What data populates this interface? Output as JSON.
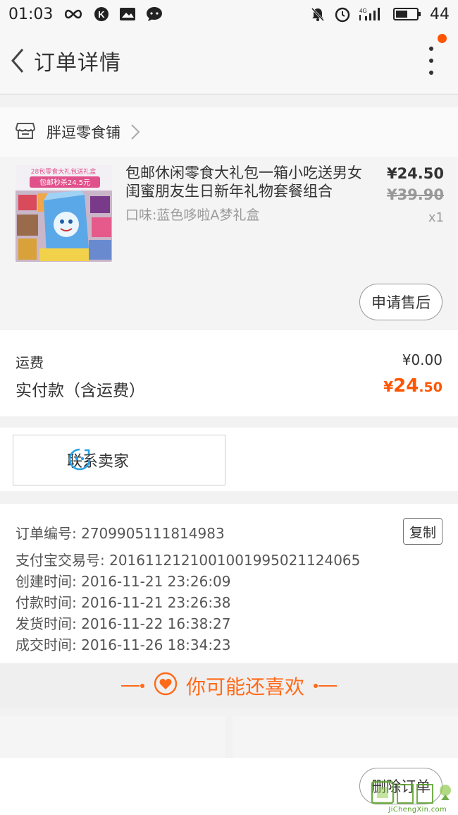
{
  "status_bar": {
    "time": "01:03",
    "battery": "44",
    "network": "4G"
  },
  "nav": {
    "title": "订单详情"
  },
  "shop": {
    "name": "胖逗零食铺"
  },
  "item": {
    "title": "包邮休闲零食大礼包一箱小吃送男女闺蜜朋友生日新年礼物套餐组合",
    "spec": "口味:蓝色哆啦A梦礼盒",
    "price": "¥24.50",
    "original_price": "¥39.90",
    "quantity": "x1",
    "thumb_text_1": "28包零食大礼包送礼盒",
    "thumb_text_2": "包邮秒杀24.5元",
    "after_sale_label": "申请售后"
  },
  "fees": {
    "shipping_label": "运费",
    "shipping_value": "¥0.00",
    "paid_label": "实付款（含运费）",
    "paid_currency": "¥",
    "paid_integer": "24",
    "paid_decimal": ".50"
  },
  "contact": {
    "label": "联系卖家"
  },
  "order_info": {
    "order_no": "订单编号: 2709905111814983",
    "alipay_no": "支付宝交易号: 2016112121001001995021124065",
    "created": "创建时间: 2016-11-21 23:26:09",
    "paid": "付款时间: 2016-11-21 23:26:38",
    "shipped": "发货时间: 2016-11-22 16:38:27",
    "completed": "成交时间: 2016-11-26 18:34:23",
    "copy_label": "复制"
  },
  "recommend": {
    "title": "你可能还喜欢"
  },
  "bottom": {
    "delete_label": "删除订单"
  },
  "watermark": {
    "text": "JiChengXin.com"
  },
  "colors": {
    "accent": "#ff5500",
    "recommend": "#ff6a1a",
    "contact_icon": "#29a1e8"
  }
}
